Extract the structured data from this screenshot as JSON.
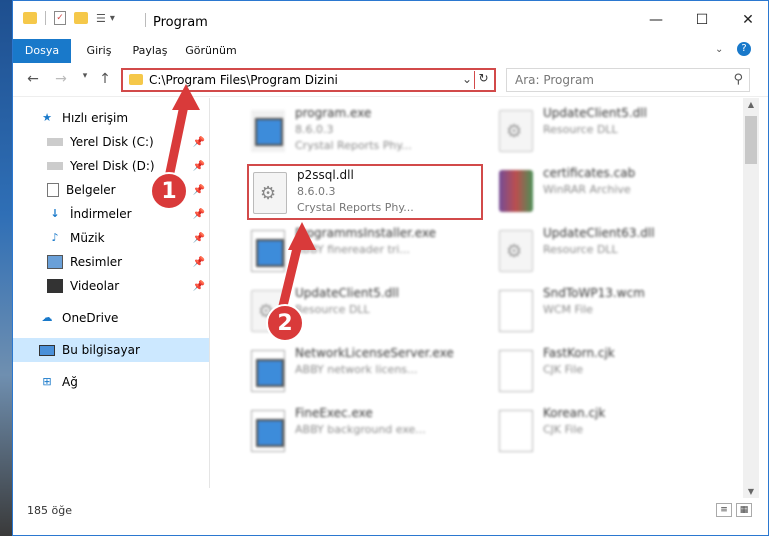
{
  "window": {
    "title": "Program"
  },
  "ribbon": {
    "tabs": [
      "Dosya",
      "Giriş",
      "Paylaş",
      "Görünüm"
    ]
  },
  "address": {
    "path": "C:\\Program Files\\Program Dizini",
    "search_placeholder": "Ara: Program"
  },
  "nav": {
    "items": [
      {
        "label": "Hızlı erişim",
        "icon": "star-icon"
      },
      {
        "label": "Yerel Disk (C:)",
        "icon": "drive-icon"
      },
      {
        "label": "Yerel Disk (D:)",
        "icon": "drive-icon"
      },
      {
        "label": "Belgeler",
        "icon": "documents-icon"
      },
      {
        "label": "İndirmeler",
        "icon": "download-icon"
      },
      {
        "label": "Müzik",
        "icon": "music-icon"
      },
      {
        "label": "Resimler",
        "icon": "pictures-icon"
      },
      {
        "label": "Videolar",
        "icon": "video-icon"
      },
      {
        "label": "OneDrive",
        "icon": "cloud-icon"
      },
      {
        "label": "Bu bilgisayar",
        "icon": "computer-icon"
      },
      {
        "label": "Ağ",
        "icon": "network-icon"
      }
    ]
  },
  "files": [
    {
      "name": "program.exe",
      "version": "8.6.0.3",
      "desc": "Crystal Reports Phy...",
      "icon": "exe-icon"
    },
    {
      "name": "UpdateClient5.dll",
      "version": "",
      "desc": "Resource DLL",
      "icon": "dll-icon"
    },
    {
      "name": "p2ssql.dll",
      "version": "8.6.0.3",
      "desc": "Crystal Reports Phy...",
      "icon": "dll-icon"
    },
    {
      "name": "certificates.cab",
      "version": "",
      "desc": "WinRAR Archive",
      "icon": "cab-icon"
    },
    {
      "name": "ProgrammsInstaller.exe",
      "version": "",
      "desc": "ABBY finereader tri...",
      "icon": "exe-icon"
    },
    {
      "name": "UpdateClient63.dll",
      "version": "",
      "desc": "Resource DLL",
      "icon": "dll-icon"
    },
    {
      "name": "UpdateClient5.dll",
      "version": "",
      "desc": "Resource DLL",
      "icon": "dll-icon"
    },
    {
      "name": "SndToWP13.wcm",
      "version": "",
      "desc": "WCM File",
      "icon": "file-icon"
    },
    {
      "name": "NetworkLicenseServer.exe",
      "version": "",
      "desc": "ABBY network licens...",
      "icon": "exe-icon"
    },
    {
      "name": "FastKorn.cjk",
      "version": "",
      "desc": "CJK File",
      "icon": "file-icon"
    },
    {
      "name": "FineExec.exe",
      "version": "",
      "desc": "ABBY background exe...",
      "icon": "exe-icon"
    },
    {
      "name": "Korean.cjk",
      "version": "",
      "desc": "CJK File",
      "icon": "file-icon"
    }
  ],
  "status": {
    "count": "185 öğe"
  },
  "annotations": [
    "1",
    "2"
  ],
  "colors": {
    "accent": "#1979ca",
    "highlight": "#d24a4a",
    "selected_nav": "#cce8ff"
  }
}
